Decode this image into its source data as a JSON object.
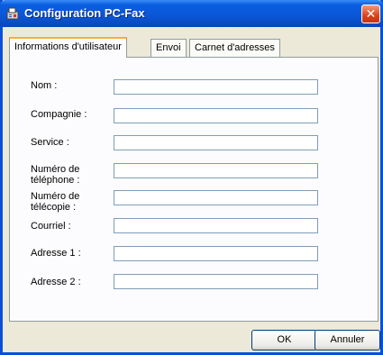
{
  "window": {
    "title": "Configuration PC-Fax"
  },
  "tabs": [
    {
      "label": "Informations d'utilisateur",
      "active": true
    },
    {
      "label": "Envoi",
      "active": false
    },
    {
      "label": "Carnet d'adresses",
      "active": false
    }
  ],
  "form": {
    "fields": [
      {
        "label_line1": "Nom :",
        "label_line2": "",
        "value": ""
      },
      {
        "label_line1": "Compagnie :",
        "label_line2": "",
        "value": ""
      },
      {
        "label_line1": "Service :",
        "label_line2": "",
        "value": ""
      },
      {
        "label_line1": "Numéro de",
        "label_line2": "téléphone :",
        "value": ""
      },
      {
        "label_line1": "Numéro de",
        "label_line2": "télécopie :",
        "value": ""
      },
      {
        "label_line1": "Courriel :",
        "label_line2": "",
        "value": ""
      },
      {
        "label_line1": "Adresse 1 :",
        "label_line2": "",
        "value": ""
      },
      {
        "label_line1": "Adresse 2 :",
        "label_line2": "",
        "value": ""
      }
    ]
  },
  "buttons": {
    "ok": "OK",
    "cancel": "Annuler"
  },
  "colors": {
    "title_bar": "#0a56d6",
    "close_button": "#d9421c",
    "active_tab_accent": "#f4b03a"
  }
}
